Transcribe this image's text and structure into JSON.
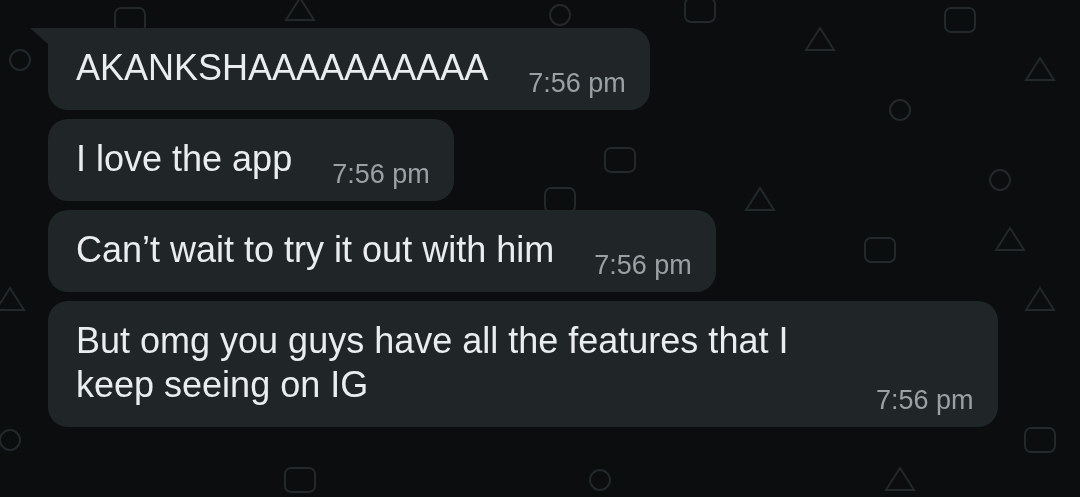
{
  "messages": [
    {
      "text": "AKANKSHAAAAAAAAAA",
      "time": "7:56 pm",
      "tail": true
    },
    {
      "text": "I love the app",
      "time": "7:56 pm",
      "tail": false
    },
    {
      "text": "Can’t wait to try it out with him",
      "time": "7:56 pm",
      "tail": false
    },
    {
      "text": "But omg you guys have all the features that I keep seeing on IG",
      "time": "7:56 pm",
      "tail": false
    }
  ]
}
